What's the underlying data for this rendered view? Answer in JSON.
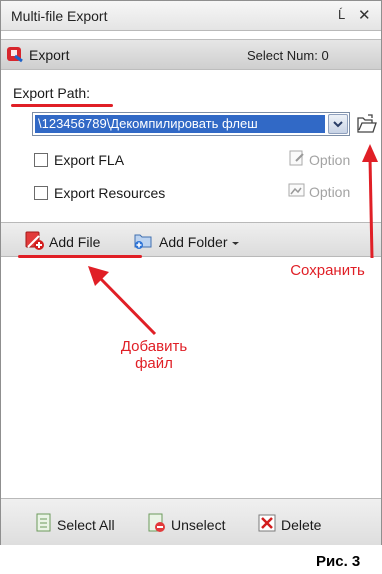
{
  "window": {
    "title": "Multi-file Export",
    "pin_glyph": "Ĺ",
    "close_glyph": "✕"
  },
  "toolbar": {
    "export_label": "Export",
    "select_num_label": "Select Num:",
    "select_num_value": "0"
  },
  "export_path": {
    "label": "Export Path:",
    "value": "\\123456789\\Декомпилировать флеш"
  },
  "options": {
    "export_fla_label": "Export  FLA",
    "export_resources_label": "Export Resources",
    "option_label_1": "Option",
    "option_label_2": "Option",
    "export_fla_checked": false,
    "export_resources_checked": false
  },
  "tabs": {
    "add_file_label": "Add File",
    "add_folder_label": "Add Folder"
  },
  "bottom": {
    "select_all_label": "Select All",
    "unselect_label": "Unselect",
    "delete_label": "Delete"
  },
  "annotations": {
    "save_label": "Сохранить",
    "add_file_label_line1": "Добавить",
    "add_file_label_line2": "файл"
  },
  "caption": "Рис. 3",
  "colors": {
    "accent_red": "#e01f26",
    "selection_blue": "#3169c6"
  },
  "icons": [
    "export-icon",
    "dropdown-arrow-icon",
    "open-folder-icon",
    "option-icon",
    "add-file-icon",
    "add-folder-icon",
    "select-all-icon",
    "unselect-icon",
    "delete-icon"
  ]
}
